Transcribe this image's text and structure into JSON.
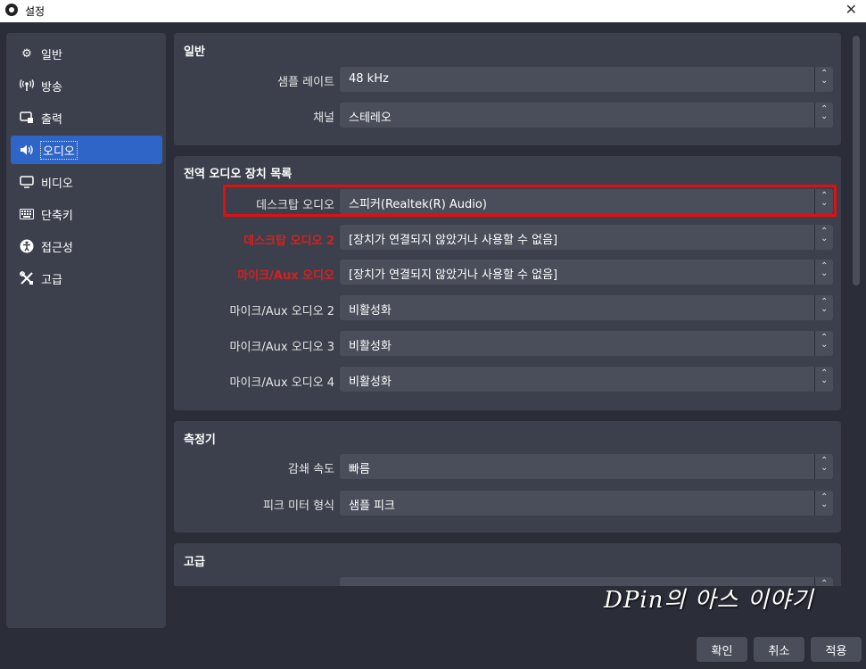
{
  "window": {
    "title": "설정",
    "close": "✕"
  },
  "sidebar": {
    "items": [
      {
        "label": "일반",
        "icon": "gear-icon"
      },
      {
        "label": "방송",
        "icon": "broadcast-icon"
      },
      {
        "label": "출력",
        "icon": "output-icon"
      },
      {
        "label": "오디오",
        "icon": "speaker-icon",
        "active": true
      },
      {
        "label": "비디오",
        "icon": "monitor-icon"
      },
      {
        "label": "단축키",
        "icon": "keyboard-icon"
      },
      {
        "label": "접근성",
        "icon": "accessibility-icon"
      },
      {
        "label": "고급",
        "icon": "tools-icon"
      }
    ]
  },
  "general": {
    "title": "일반",
    "sample_rate_label": "샘플 레이트",
    "sample_rate_value": "48 kHz",
    "channel_label": "채널",
    "channel_value": "스테레오"
  },
  "global_audio": {
    "title": "전역 오디오 장치 목록",
    "rows": [
      {
        "label": "데스크탑 오디오",
        "value": "스피커(Realtek(R) Audio)"
      },
      {
        "label": "데스크탑 오디오 2",
        "value": "[장치가 연결되지 않았거나 사용할 수 없음]"
      },
      {
        "label": "마이크/Aux 오디오",
        "value": "[장치가 연결되지 않았거나 사용할 수 없음]"
      },
      {
        "label": "마이크/Aux 오디오 2",
        "value": "비활성화"
      },
      {
        "label": "마이크/Aux 오디오 3",
        "value": "비활성화"
      },
      {
        "label": "마이크/Aux 오디오 4",
        "value": "비활성화"
      }
    ]
  },
  "meters": {
    "title": "측정기",
    "decay_label": "감쇄 속도",
    "decay_value": "빠름",
    "peak_label": "피크 미터 형식",
    "peak_value": "샘플 피크"
  },
  "advanced": {
    "title": "고급"
  },
  "buttons": {
    "ok": "확인",
    "cancel": "취소",
    "apply": "적용"
  },
  "watermark": "DPin의 아스 이야기",
  "colors": {
    "accent": "#2f65c7",
    "highlight": "#e01010",
    "warning_label": "#d62020"
  }
}
